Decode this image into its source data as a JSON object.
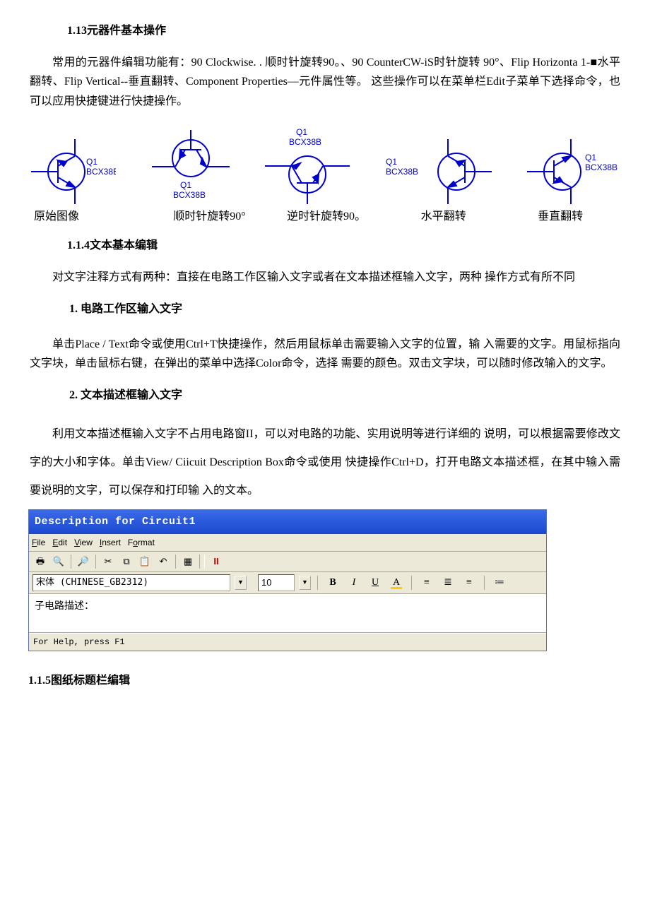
{
  "sec113": {
    "title": "1.13元器件基本操作",
    "para": "常用的元器件编辑功能有：90 Clockwise. . 顺时针旋转90。、90 CounterCW-iS时针旋转 90°、Flip Horizonta 1-■水平翻转、Flip Vertical--垂直翻转、Component Properties—元件属性等。 这些操作可以在菜单栏Edit子菜单下选择命令，也可以应用快捷键进行快捷操作。"
  },
  "fig_labels": {
    "q": "Q1",
    "part": "BCX38B"
  },
  "captions": {
    "c1": "原始图像",
    "c2": "顺时针旋转90°",
    "c3": "逆时针旋转90。",
    "c4": "水平翻转",
    "c5": "垂直翻转"
  },
  "sec114": {
    "title": "1.1.4文本基本编辑",
    "para": "对文字注释方式有两种：直接在电路工作区输入文字或者在文本描述框输入文字，两种 操作方式有所不同"
  },
  "sub1": {
    "title": "1.   电路工作区输入文字",
    "para": "单击Place  /  Text命令或使用Ctrl+T快捷操作，然后用鼠标单击需要输入文字的位置，输 入需要的文字。用鼠标指向文字块，单击鼠标右键，在弹出的菜单中选择Color命令，选择 需要的颜色。双击文字块，可以随时修改输入的文字。"
  },
  "sub2": {
    "title": "2.   文本描述框输入文字",
    "para": "利用文本描述框输入文字不占用电路窗II，可以对电路的功能、实用说明等进行详细的 说明，可以根据需要修改文字的大小和字体。单击View/ Ciicuit Description Box命令或使用  快捷操作Ctrl+D，打开电路文本描述框，在其中输入需要说明的文字，可以保存和打印输 入的文本。"
  },
  "descwin": {
    "title": "Description for Circuit1",
    "menu": {
      "file": "File",
      "edit": "Edit",
      "view": "View",
      "insert": "Insert",
      "format": "Format"
    },
    "font_name": "宋体 (CHINESE_GB2312)",
    "font_size": "10",
    "body": "子电路描述：",
    "status": "For Help, press F1",
    "fmt": {
      "b": "B",
      "i": "I",
      "u": "U"
    },
    "pause": "II"
  },
  "sec115": {
    "title": "1.1.5图纸标题栏编辑"
  }
}
